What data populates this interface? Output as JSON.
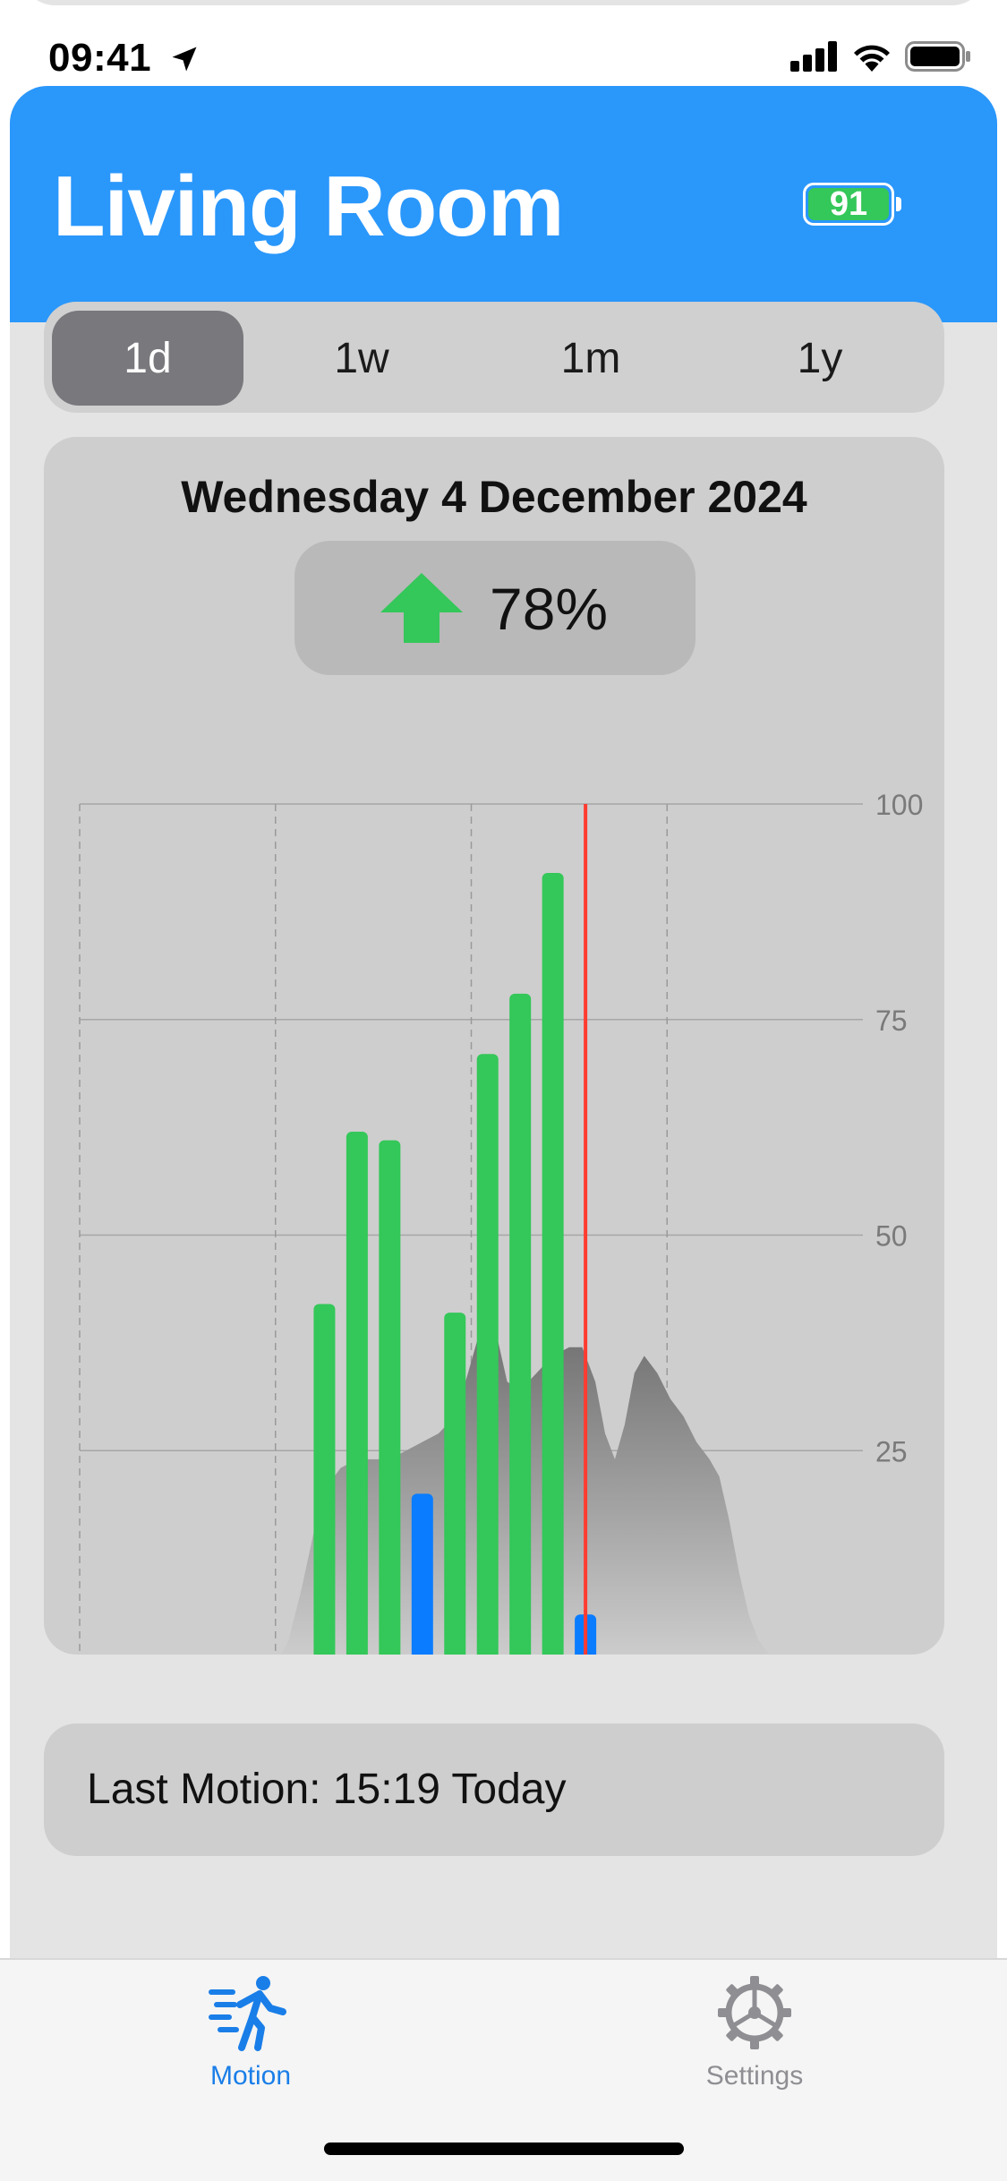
{
  "status_bar": {
    "time": "09:41"
  },
  "header": {
    "title": "Living Room",
    "battery_level": "91"
  },
  "range_tabs": [
    {
      "label": "1d",
      "selected": true
    },
    {
      "label": "1w",
      "selected": false
    },
    {
      "label": "1m",
      "selected": false
    },
    {
      "label": "1y",
      "selected": false
    }
  ],
  "chart_card": {
    "date": "Wednesday 4 December 2024",
    "trend_value": "78%",
    "trend_direction": "up"
  },
  "last_motion": {
    "text": "Last Motion: 15:19 Today"
  },
  "tab_bar": {
    "items": [
      {
        "label": "Motion",
        "icon": "running-person-icon",
        "selected": true
      },
      {
        "label": "Settings",
        "icon": "gear-icon",
        "selected": false
      }
    ]
  },
  "colors": {
    "header": "#2a97fb",
    "accent": "#1a7ee8",
    "green_bar": "#34c759",
    "blue_bar": "#0a7cff",
    "marker": "#ff3b30"
  },
  "chart_data": {
    "type": "bar",
    "x_ticks": [
      "00",
      "06",
      "12",
      "18"
    ],
    "xlim": [
      0,
      24
    ],
    "ylim": [
      0,
      100
    ],
    "y_ticks": [
      "0",
      "25",
      "50",
      "75",
      "100"
    ],
    "bars": [
      {
        "hour": 7.5,
        "value": 42,
        "color": "green"
      },
      {
        "hour": 8.5,
        "value": 62,
        "color": "green"
      },
      {
        "hour": 9.5,
        "value": 61,
        "color": "green"
      },
      {
        "hour": 10.5,
        "value": 20,
        "color": "blue"
      },
      {
        "hour": 11.5,
        "value": 41,
        "color": "green"
      },
      {
        "hour": 12.5,
        "value": 71,
        "color": "green"
      },
      {
        "hour": 13.5,
        "value": 78,
        "color": "green"
      },
      {
        "hour": 14.5,
        "value": 92,
        "color": "green"
      },
      {
        "hour": 15.5,
        "value": 6,
        "color": "blue"
      }
    ],
    "marker_hour": 15.5,
    "area_series": [
      [
        6.0,
        0
      ],
      [
        6.4,
        3
      ],
      [
        6.8,
        9
      ],
      [
        7.2,
        16
      ],
      [
        7.6,
        21
      ],
      [
        8.0,
        23
      ],
      [
        8.5,
        24
      ],
      [
        9.0,
        24
      ],
      [
        9.5,
        24
      ],
      [
        10.0,
        25
      ],
      [
        10.5,
        26
      ],
      [
        11.0,
        27
      ],
      [
        11.5,
        29
      ],
      [
        11.9,
        34
      ],
      [
        12.2,
        38
      ],
      [
        12.5,
        40
      ],
      [
        12.8,
        38
      ],
      [
        13.1,
        33
      ],
      [
        13.5,
        32
      ],
      [
        14.0,
        34
      ],
      [
        14.5,
        36
      ],
      [
        15.0,
        37
      ],
      [
        15.4,
        37
      ],
      [
        15.8,
        33
      ],
      [
        16.1,
        27
      ],
      [
        16.4,
        24
      ],
      [
        16.7,
        28
      ],
      [
        17.0,
        34
      ],
      [
        17.3,
        36
      ],
      [
        17.7,
        34
      ],
      [
        18.1,
        31
      ],
      [
        18.5,
        29
      ],
      [
        18.9,
        26
      ],
      [
        19.3,
        24
      ],
      [
        19.6,
        22
      ],
      [
        19.9,
        17
      ],
      [
        20.2,
        11
      ],
      [
        20.5,
        6
      ],
      [
        20.8,
        3
      ],
      [
        21.2,
        1
      ],
      [
        21.6,
        0
      ],
      [
        24.0,
        0
      ]
    ]
  }
}
